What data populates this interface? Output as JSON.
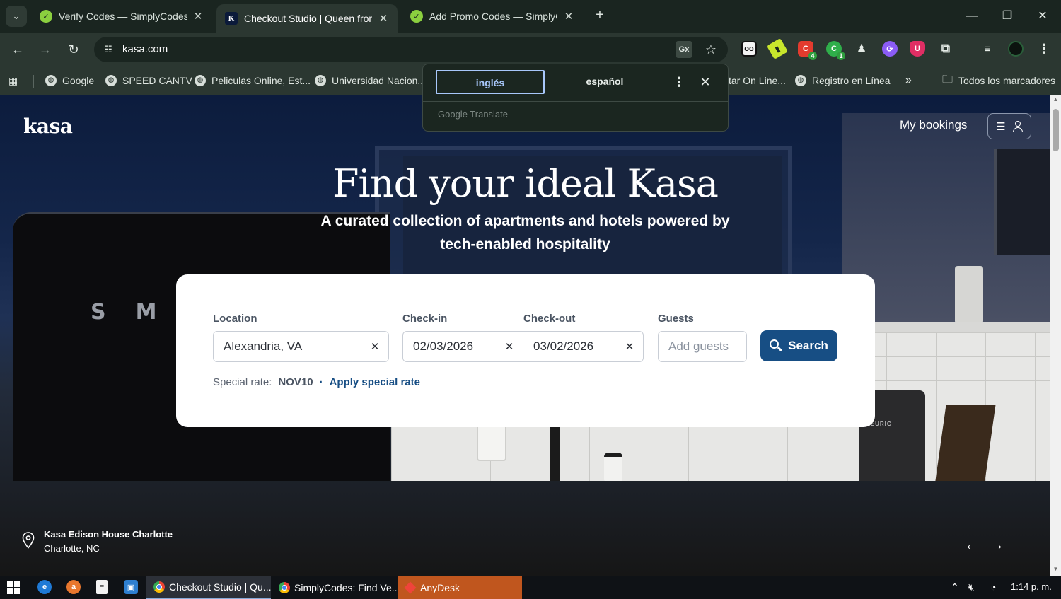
{
  "browser": {
    "tabs": [
      {
        "title": "Verify Codes — SimplyCodes",
        "active": false
      },
      {
        "title": "Checkout Studio | Queen from Kasa",
        "active": true
      },
      {
        "title": "Add Promo Codes — SimplyCodes",
        "active": false
      }
    ],
    "url": "kasa.com",
    "translate_icon": "Gx",
    "extensions": [
      {
        "icon": "oo-icon",
        "badge": ""
      },
      {
        "icon": "tag-icon",
        "badge": ""
      },
      {
        "icon": "red-extension-icon",
        "badge": "4"
      },
      {
        "icon": "green-extension-icon",
        "badge": "1"
      },
      {
        "icon": "puppet-icon",
        "badge": ""
      },
      {
        "icon": "purple-extension-icon",
        "badge": ""
      },
      {
        "icon": "shield-icon",
        "badge": ""
      },
      {
        "icon": "puzzle-icon",
        "badge": ""
      }
    ],
    "bookmarks": [
      "Google",
      "SPEED CANTV",
      "Peliculas Online, Est...",
      "Universidad Nacion...",
      "tar On Line...",
      "Registro en Línea"
    ],
    "bookmarks_overflow": "»",
    "all_bookmarks": "Todos los marcadores"
  },
  "translate_popup": {
    "source_lang": "inglés",
    "target_lang": "español",
    "brand": "Google Translate"
  },
  "page": {
    "logo": "kasa",
    "my_bookings": "My bookings",
    "hero_title": "Find your ideal Kasa",
    "hero_subtitle": "A curated collection of apartments and hotels powered by tech-enabled hospitality",
    "search": {
      "location_label": "Location",
      "location_value": "Alexandria, VA",
      "checkin_label": "Check-in",
      "checkin_value": "02/03/2026",
      "checkout_label": "Check-out",
      "checkout_value": "03/02/2026",
      "guests_label": "Guests",
      "guests_placeholder": "Add guests",
      "search_button": "Search",
      "special_rate_label": "Special rate:",
      "special_rate_code": "NOV10",
      "separator": "·",
      "apply_link": "Apply special rate"
    },
    "fridge_brand": "SM",
    "keurig_label": "KEURIG",
    "property": {
      "name": "Kasa Edison House Charlotte",
      "city": "Charlotte, NC"
    }
  },
  "taskbar": {
    "apps": [
      {
        "label": "Checkout Studio | Qu...",
        "active": true
      },
      {
        "label": "SimplyCodes: Find Ve...",
        "active": false
      },
      {
        "label": "AnyDesk",
        "active": false
      }
    ],
    "time": "1:14 p. m."
  }
}
